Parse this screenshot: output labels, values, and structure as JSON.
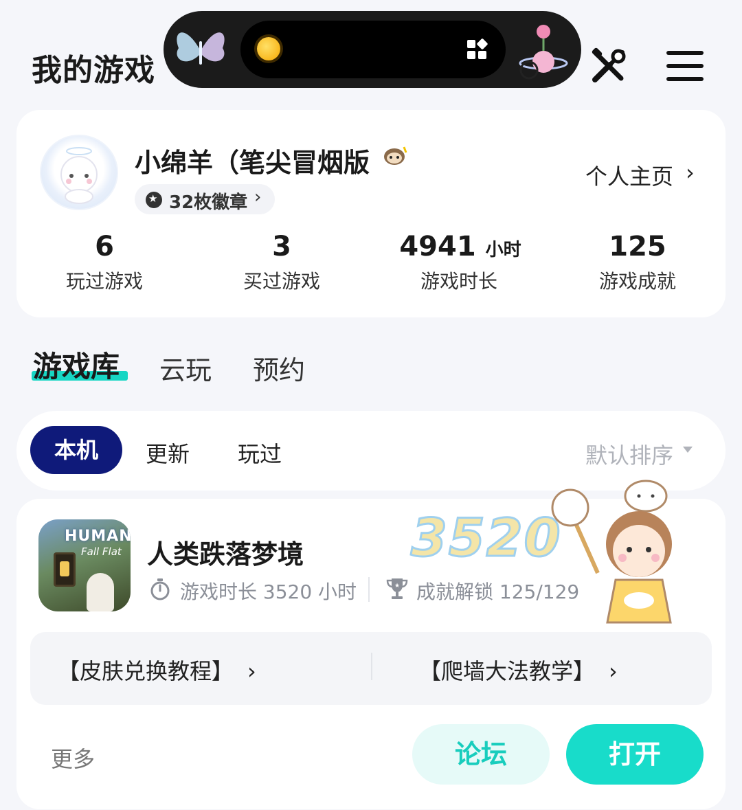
{
  "header": {
    "title": "我的游戏"
  },
  "profile": {
    "username": "小绵羊（笔尖冒烟版",
    "badges_label": "32枚徽章",
    "homepage_label": "个人主页",
    "stats": [
      {
        "value": "6",
        "unit": "",
        "label": "玩过游戏"
      },
      {
        "value": "3",
        "unit": "",
        "label": "买过游戏"
      },
      {
        "value": "4941",
        "unit": "小时",
        "label": "游戏时长"
      },
      {
        "value": "125",
        "unit": "",
        "label": "游戏成就"
      }
    ]
  },
  "tabs": [
    {
      "label": "游戏库",
      "active": true
    },
    {
      "label": "云玩",
      "active": false
    },
    {
      "label": "预约",
      "active": false
    }
  ],
  "filters": {
    "chips": [
      {
        "label": "本机",
        "active": true
      },
      {
        "label": "更新",
        "active": false
      },
      {
        "label": "玩过",
        "active": false
      }
    ],
    "sort_label": "默认排序"
  },
  "game": {
    "title": "人类跌落梦境",
    "icon_logo_line1": "HUMAN",
    "icon_logo_line2": "Fall Flat",
    "playtime": "游戏时长 3520 小时",
    "achievements": "成就解锁 125/129",
    "sticker_number": "3520",
    "links": [
      "【皮肤兑换教程】",
      "【爬墙大法教学】"
    ],
    "more_label": "更多",
    "forum_label": "论坛",
    "open_label": "打开"
  },
  "colors": {
    "accent": "#18dcca",
    "chip_active": "#0f1a7a",
    "background": "#f5f6fa"
  }
}
